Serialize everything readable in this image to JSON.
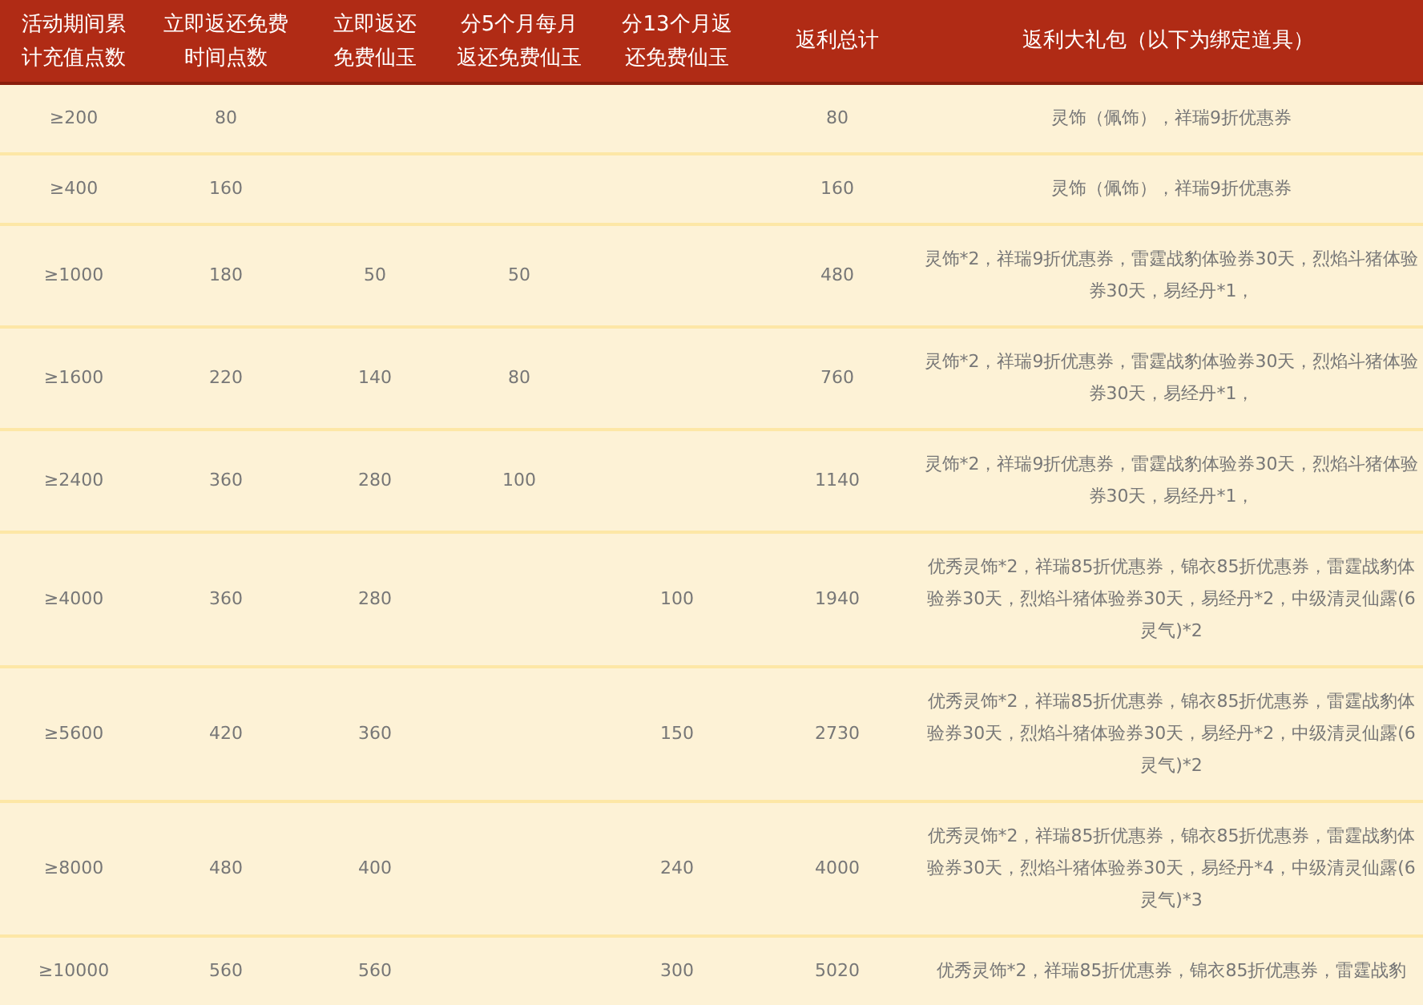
{
  "table": {
    "columns": [
      {
        "lines": [
          "活动期间累",
          "计充值点数"
        ]
      },
      {
        "lines": [
          "立即返还免费",
          "时间点数"
        ]
      },
      {
        "lines": [
          "立即返还",
          "免费仙玉"
        ]
      },
      {
        "lines": [
          "分5个月每月",
          "返还免费仙玉"
        ]
      },
      {
        "lines": [
          "分13个月返",
          "还免费仙玉"
        ]
      },
      {
        "lines": [
          "返利总计"
        ]
      },
      {
        "lines": [
          "返利大礼包（以下为绑定道具）"
        ]
      }
    ],
    "rows": [
      {
        "cells": [
          "≥200",
          "80",
          "",
          "",
          "",
          "80",
          "灵饰（佩饰），祥瑞9折优惠券"
        ]
      },
      {
        "cells": [
          "≥400",
          "160",
          "",
          "",
          "",
          "160",
          "灵饰（佩饰），祥瑞9折优惠券"
        ]
      },
      {
        "cells": [
          "≥1000",
          "180",
          "50",
          "50",
          "",
          "480",
          "灵饰*2，祥瑞9折优惠券，雷霆战豹体验券30天，烈焰斗猪体验券30天，易经丹*1，"
        ]
      },
      {
        "cells": [
          "≥1600",
          "220",
          "140",
          "80",
          "",
          "760",
          "灵饰*2，祥瑞9折优惠券，雷霆战豹体验券30天，烈焰斗猪体验券30天，易经丹*1，"
        ]
      },
      {
        "cells": [
          "≥2400",
          "360",
          "280",
          "100",
          "",
          "1140",
          "灵饰*2，祥瑞9折优惠券，雷霆战豹体验券30天，烈焰斗猪体验券30天，易经丹*1，"
        ]
      },
      {
        "cells": [
          "≥4000",
          "360",
          "280",
          "",
          "100",
          "1940",
          "优秀灵饰*2，祥瑞85折优惠券，锦衣85折优惠券，雷霆战豹体验券30天，烈焰斗猪体验券30天，易经丹*2，中级清灵仙露(6灵气)*2"
        ]
      },
      {
        "cells": [
          "≥5600",
          "420",
          "360",
          "",
          "150",
          "2730",
          "优秀灵饰*2，祥瑞85折优惠券，锦衣85折优惠券，雷霆战豹体验券30天，烈焰斗猪体验券30天，易经丹*2，中级清灵仙露(6灵气)*2"
        ]
      },
      {
        "cells": [
          "≥8000",
          "480",
          "400",
          "",
          "240",
          "4000",
          "优秀灵饰*2，祥瑞85折优惠券，锦衣85折优惠券，雷霆战豹体验券30天，烈焰斗猪体验券30天，易经丹*4，中级清灵仙露(6灵气)*3"
        ]
      },
      {
        "cells": [
          "≥10000",
          "560",
          "560",
          "",
          "300",
          "5020",
          "优秀灵饰*2，祥瑞85折优惠券，锦衣85折优惠券，雷霆战豹"
        ]
      }
    ]
  }
}
